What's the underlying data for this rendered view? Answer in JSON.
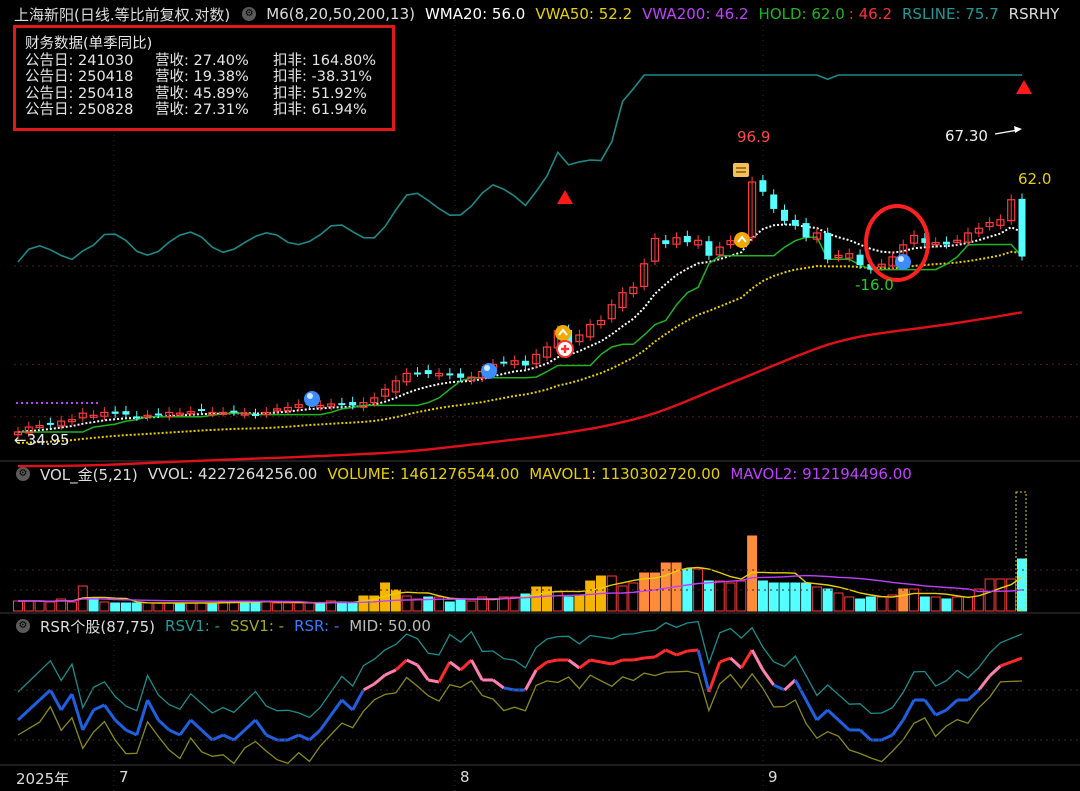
{
  "main_header": {
    "stock_name": "上海新阳",
    "chart_mode": "(日线.等比前复权.对数)",
    "indicator_name": "M6(8,20,50,200,13)",
    "wma20": "WMA20: 56.0",
    "vwa50": "VWA50: 52.2",
    "vwa200": "VWA200: 46.2",
    "hold": "HOLD: 62.0",
    "hold_val2": ": 46.2",
    "rsline": "RSLINE: 75.7",
    "rsrh": "RSRHY"
  },
  "fin_box": {
    "title": "财务数据(单季同比)",
    "rows": [
      {
        "date": "公告日: 241030",
        "rev": "营收:  27.40%",
        "net": "扣非:  164.80%"
      },
      {
        "date": "公告日: 250418",
        "rev": "营收:  19.38%",
        "net": "扣非:  -38.31%"
      },
      {
        "date": "公告日: 250418",
        "rev": "营收:  45.89%",
        "net": "扣非:  51.92%"
      },
      {
        "date": "公告日: 250828",
        "rev": "营收:  27.31%",
        "net": "扣非:  61.94%"
      }
    ]
  },
  "annotations": {
    "high_label": "96.9",
    "low_label": "-16.0",
    "latest_label": "67.30",
    "hold_label": "62.0",
    "start_label": "34.95"
  },
  "vol_header": {
    "name": "VOL_金(5,21)",
    "vvol": "VVOL: 4227264256.00",
    "volume": "VOLUME: 1461276544.00",
    "mavol1": "MAVOL1: 1130302720.00",
    "mavol2": "MAVOL2: 912194496.00"
  },
  "rsr_header": {
    "name": "RSR个股(87,75)",
    "rsv1": "RSV1: -",
    "ssv1": "SSV1: -",
    "rsr": "RSR: -",
    "mid": "MID: 50.00"
  },
  "x_axis": {
    "year": "2025年",
    "m7": "7",
    "m8": "8",
    "m9": "9"
  },
  "colors": {
    "up": "#ff3b3b",
    "down": "#54ffff",
    "wma": "#ffffff",
    "vwa50": "#e8d000",
    "vwa200": "#e0101a",
    "hold": "#1fb51f",
    "rsline": "#1e8a8a",
    "rsr_pink": "#ff7fb0",
    "rsr_blue": "#1f5fe0",
    "rsv_line": "#1c8d8d",
    "ssv_line": "#8a8a1c"
  },
  "chart_data": {
    "type": "candlestick",
    "closes": [
      34.95,
      35.6,
      35.8,
      36,
      36.4,
      36.6,
      37.5,
      37.2,
      37.6,
      37.4,
      37.3,
      37,
      37.2,
      37.4,
      37.6,
      37.5,
      37.7,
      37.8,
      37.6,
      37.6,
      37.7,
      37.5,
      37.3,
      37.6,
      38.1,
      38.3,
      38.7,
      38.8,
      38.6,
      38.8,
      38.7,
      38.6,
      39,
      39.7,
      41,
      42.3,
      43.5,
      43.6,
      43.4,
      43.5,
      43.2,
      42.8,
      42.9,
      43.8,
      45,
      45.3,
      45.6,
      44.8,
      46.7,
      48,
      51,
      48.5,
      50.2,
      52.2,
      53,
      56.2,
      58.8,
      60,
      65.5,
      72,
      70.5,
      72.2,
      71,
      71.5,
      67.5,
      69.7,
      71.4,
      72.3,
      88.9,
      85.7,
      80.4,
      76.9,
      75.5,
      72.3,
      73.5,
      66.6,
      67.6,
      68,
      65.2,
      64.1,
      65.4,
      67.2,
      70.3,
      72.8,
      70.8,
      70.9,
      70.4,
      71.5,
      73.5,
      74.8,
      76.4,
      77.2,
      83.2,
      67.3
    ],
    "volume_highlights": "orange bars mark high volume days"
  }
}
